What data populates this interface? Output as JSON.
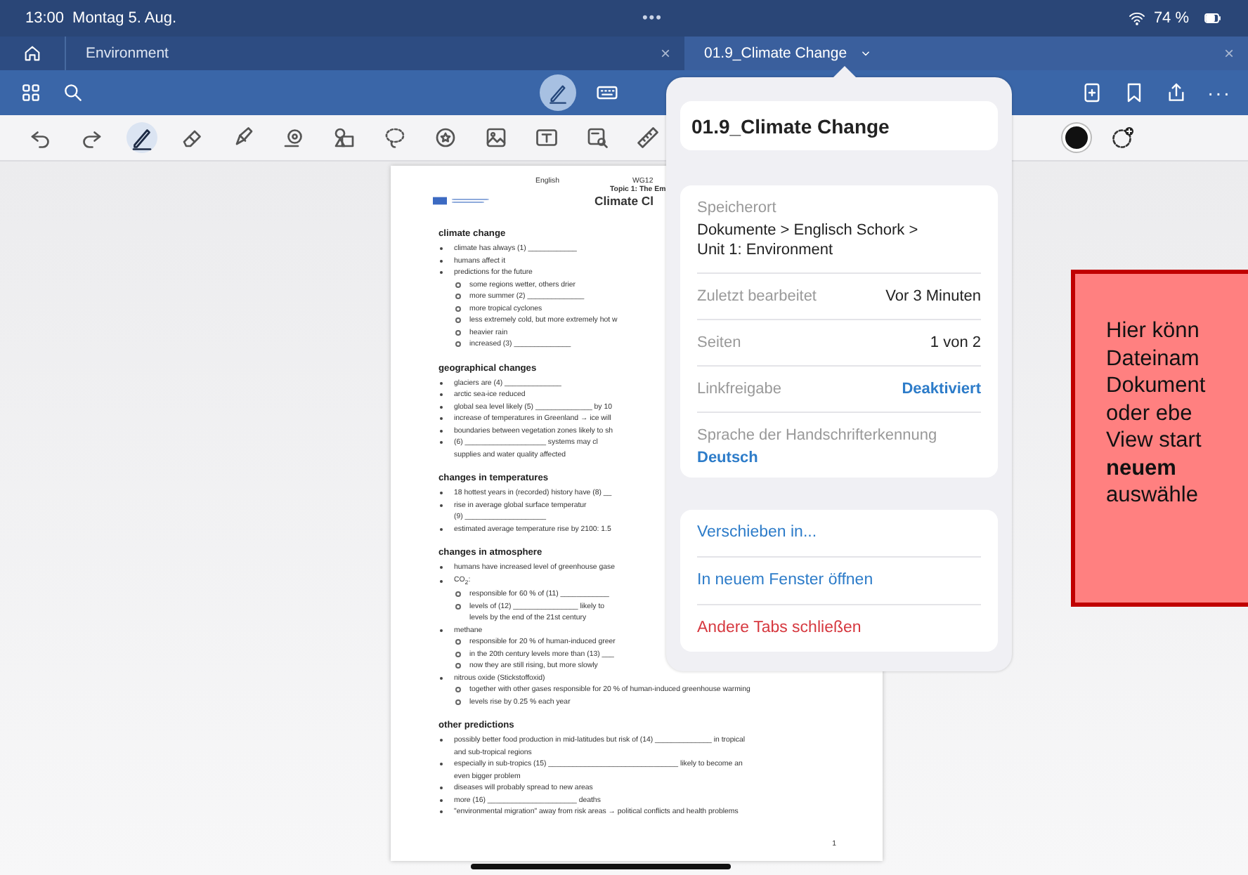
{
  "status_bar": {
    "time": "13:00",
    "date": "Montag 5. Aug.",
    "dots": "•••",
    "battery": "74 %"
  },
  "tabs": [
    {
      "label": "Environment",
      "close": "×",
      "selected": false
    },
    {
      "label": "01.9_Climate Change",
      "close": "×",
      "selected": true
    }
  ],
  "toolbar": {
    "more": "···"
  },
  "tools": [
    {
      "kind": "undo",
      "selected": false
    },
    {
      "kind": "redo",
      "selected": false
    },
    {
      "kind": "pen",
      "selected": true
    },
    {
      "kind": "eraser",
      "selected": false
    },
    {
      "kind": "highlighter",
      "selected": false
    },
    {
      "kind": "tape",
      "selected": false
    },
    {
      "kind": "shapes",
      "selected": false
    },
    {
      "kind": "lasso",
      "selected": false
    },
    {
      "kind": "sticker",
      "selected": false
    },
    {
      "kind": "image",
      "selected": false
    },
    {
      "kind": "text",
      "selected": false
    },
    {
      "kind": "camera",
      "selected": false
    },
    {
      "kind": "ruler",
      "selected": false
    }
  ],
  "document": {
    "subject": "English",
    "class": "WG12",
    "topic": "Topic 1: The Em",
    "title": "Climate Cl",
    "page_number": "1",
    "sections": [
      {
        "heading": "climate change",
        "items": [
          {
            "lines": [
              "climate has always (1) ____________"
            ]
          },
          {
            "lines": [
              "humans affect it"
            ]
          },
          {
            "lines": [
              "predictions for the future"
            ],
            "children": [
              {
                "lines": [
                  "some regions wetter, others drier"
                ]
              },
              {
                "lines": [
                  "more summer (2) ______________"
                ]
              },
              {
                "lines": [
                  "more tropical cyclones"
                ]
              },
              {
                "lines": [
                  "less extremely cold, but more extremely hot w"
                ]
              },
              {
                "lines": [
                  "heavier rain"
                ]
              },
              {
                "lines": [
                  "increased (3) ______________"
                ]
              }
            ]
          }
        ]
      },
      {
        "heading": "geographical changes",
        "items": [
          {
            "lines": [
              "glaciers are (4) ______________"
            ]
          },
          {
            "lines": [
              "arctic sea-ice reduced"
            ]
          },
          {
            "lines": [
              "global sea level likely (5) ______________ by 10"
            ]
          },
          {
            "lines": [
              "increase of temperatures in Greenland → ice will"
            ]
          },
          {
            "lines": [
              "boundaries between vegetation zones likely to sh"
            ]
          },
          {
            "lines": [
              "(6) ____________________ systems may cl",
              "supplies and water quality affected"
            ]
          }
        ]
      },
      {
        "heading": "changes in temperatures",
        "items": [
          {
            "lines": [
              "18 hottest years in (recorded) history have (8) __"
            ]
          },
          {
            "lines": [
              "rise in average global surface temperatur",
              "(9) ____________________"
            ]
          },
          {
            "lines": [
              "estimated average temperature rise by 2100: 1.5"
            ]
          }
        ]
      },
      {
        "heading": "changes in atmosphere",
        "items": [
          {
            "lines": [
              "humans have increased level of greenhouse gase"
            ]
          },
          {
            "lines": [
              "CO$_{2}$:"
            ],
            "children": [
              {
                "lines": [
                  "responsible for 60 % of (11) ____________"
                ]
              },
              {
                "lines": [
                  "levels of (12) ________________ likely to",
                  "levels by the end of the 21st century"
                ]
              }
            ]
          },
          {
            "lines": [
              "methane"
            ],
            "children": [
              {
                "lines": [
                  "responsible for 20 % of human-induced greer"
                ]
              },
              {
                "lines": [
                  "in the 20th century levels more than (13) ___"
                ]
              },
              {
                "lines": [
                  "now they are still rising, but more slowly"
                ]
              }
            ]
          },
          {
            "lines": [
              "nitrous oxide (Stickstoffoxid)"
            ],
            "children": [
              {
                "lines": [
                  "together with other gases responsible for 20 % of human-induced greenhouse warming"
                ]
              },
              {
                "lines": [
                  "levels rise by 0.25 % each year"
                ]
              }
            ]
          }
        ]
      },
      {
        "heading": "other predictions",
        "items": [
          {
            "lines": [
              "possibly better food production in mid-latitudes but risk of (14) ______________ in tropical",
              "and sub-tropical regions"
            ]
          },
          {
            "lines": [
              "especially in sub-tropics (15) ________________________________ likely to become an",
              "even bigger problem"
            ]
          },
          {
            "lines": [
              "diseases will probably spread to new areas"
            ]
          },
          {
            "lines": [
              "more (16) ______________________ deaths"
            ]
          },
          {
            "lines": [
              "\"environmental migration\" away from risk areas → political conflicts and health problems"
            ]
          }
        ]
      }
    ]
  },
  "popover": {
    "file_name": "01.9_Climate Change",
    "location_label": "Speicherort",
    "location": "Dokumente > Englisch Schork >\nUnit 1: Environment",
    "rows": [
      {
        "label": "Zuletzt bearbeitet",
        "value": "Vor 3 Minuten",
        "kind": "plain"
      },
      {
        "label": "Seiten",
        "value": "1 von 2",
        "kind": "plain"
      },
      {
        "label": "Linkfreigabe",
        "value": "Deaktiviert",
        "kind": "link"
      }
    ],
    "language_label": "Sprache der Handschrifterkennung",
    "language": "Deutsch",
    "actions": [
      {
        "label": "Verschieben in...",
        "kind": "normal"
      },
      {
        "label": "In neuem Fenster öffnen",
        "kind": "normal"
      },
      {
        "label": "Andere Tabs schließen",
        "kind": "destructive"
      }
    ]
  },
  "callout": {
    "lines": [
      "Hier könn",
      "Dateinam",
      "Dokument",
      "oder ebe",
      "View start",
      "**neuem**",
      "auswähle"
    ]
  }
}
